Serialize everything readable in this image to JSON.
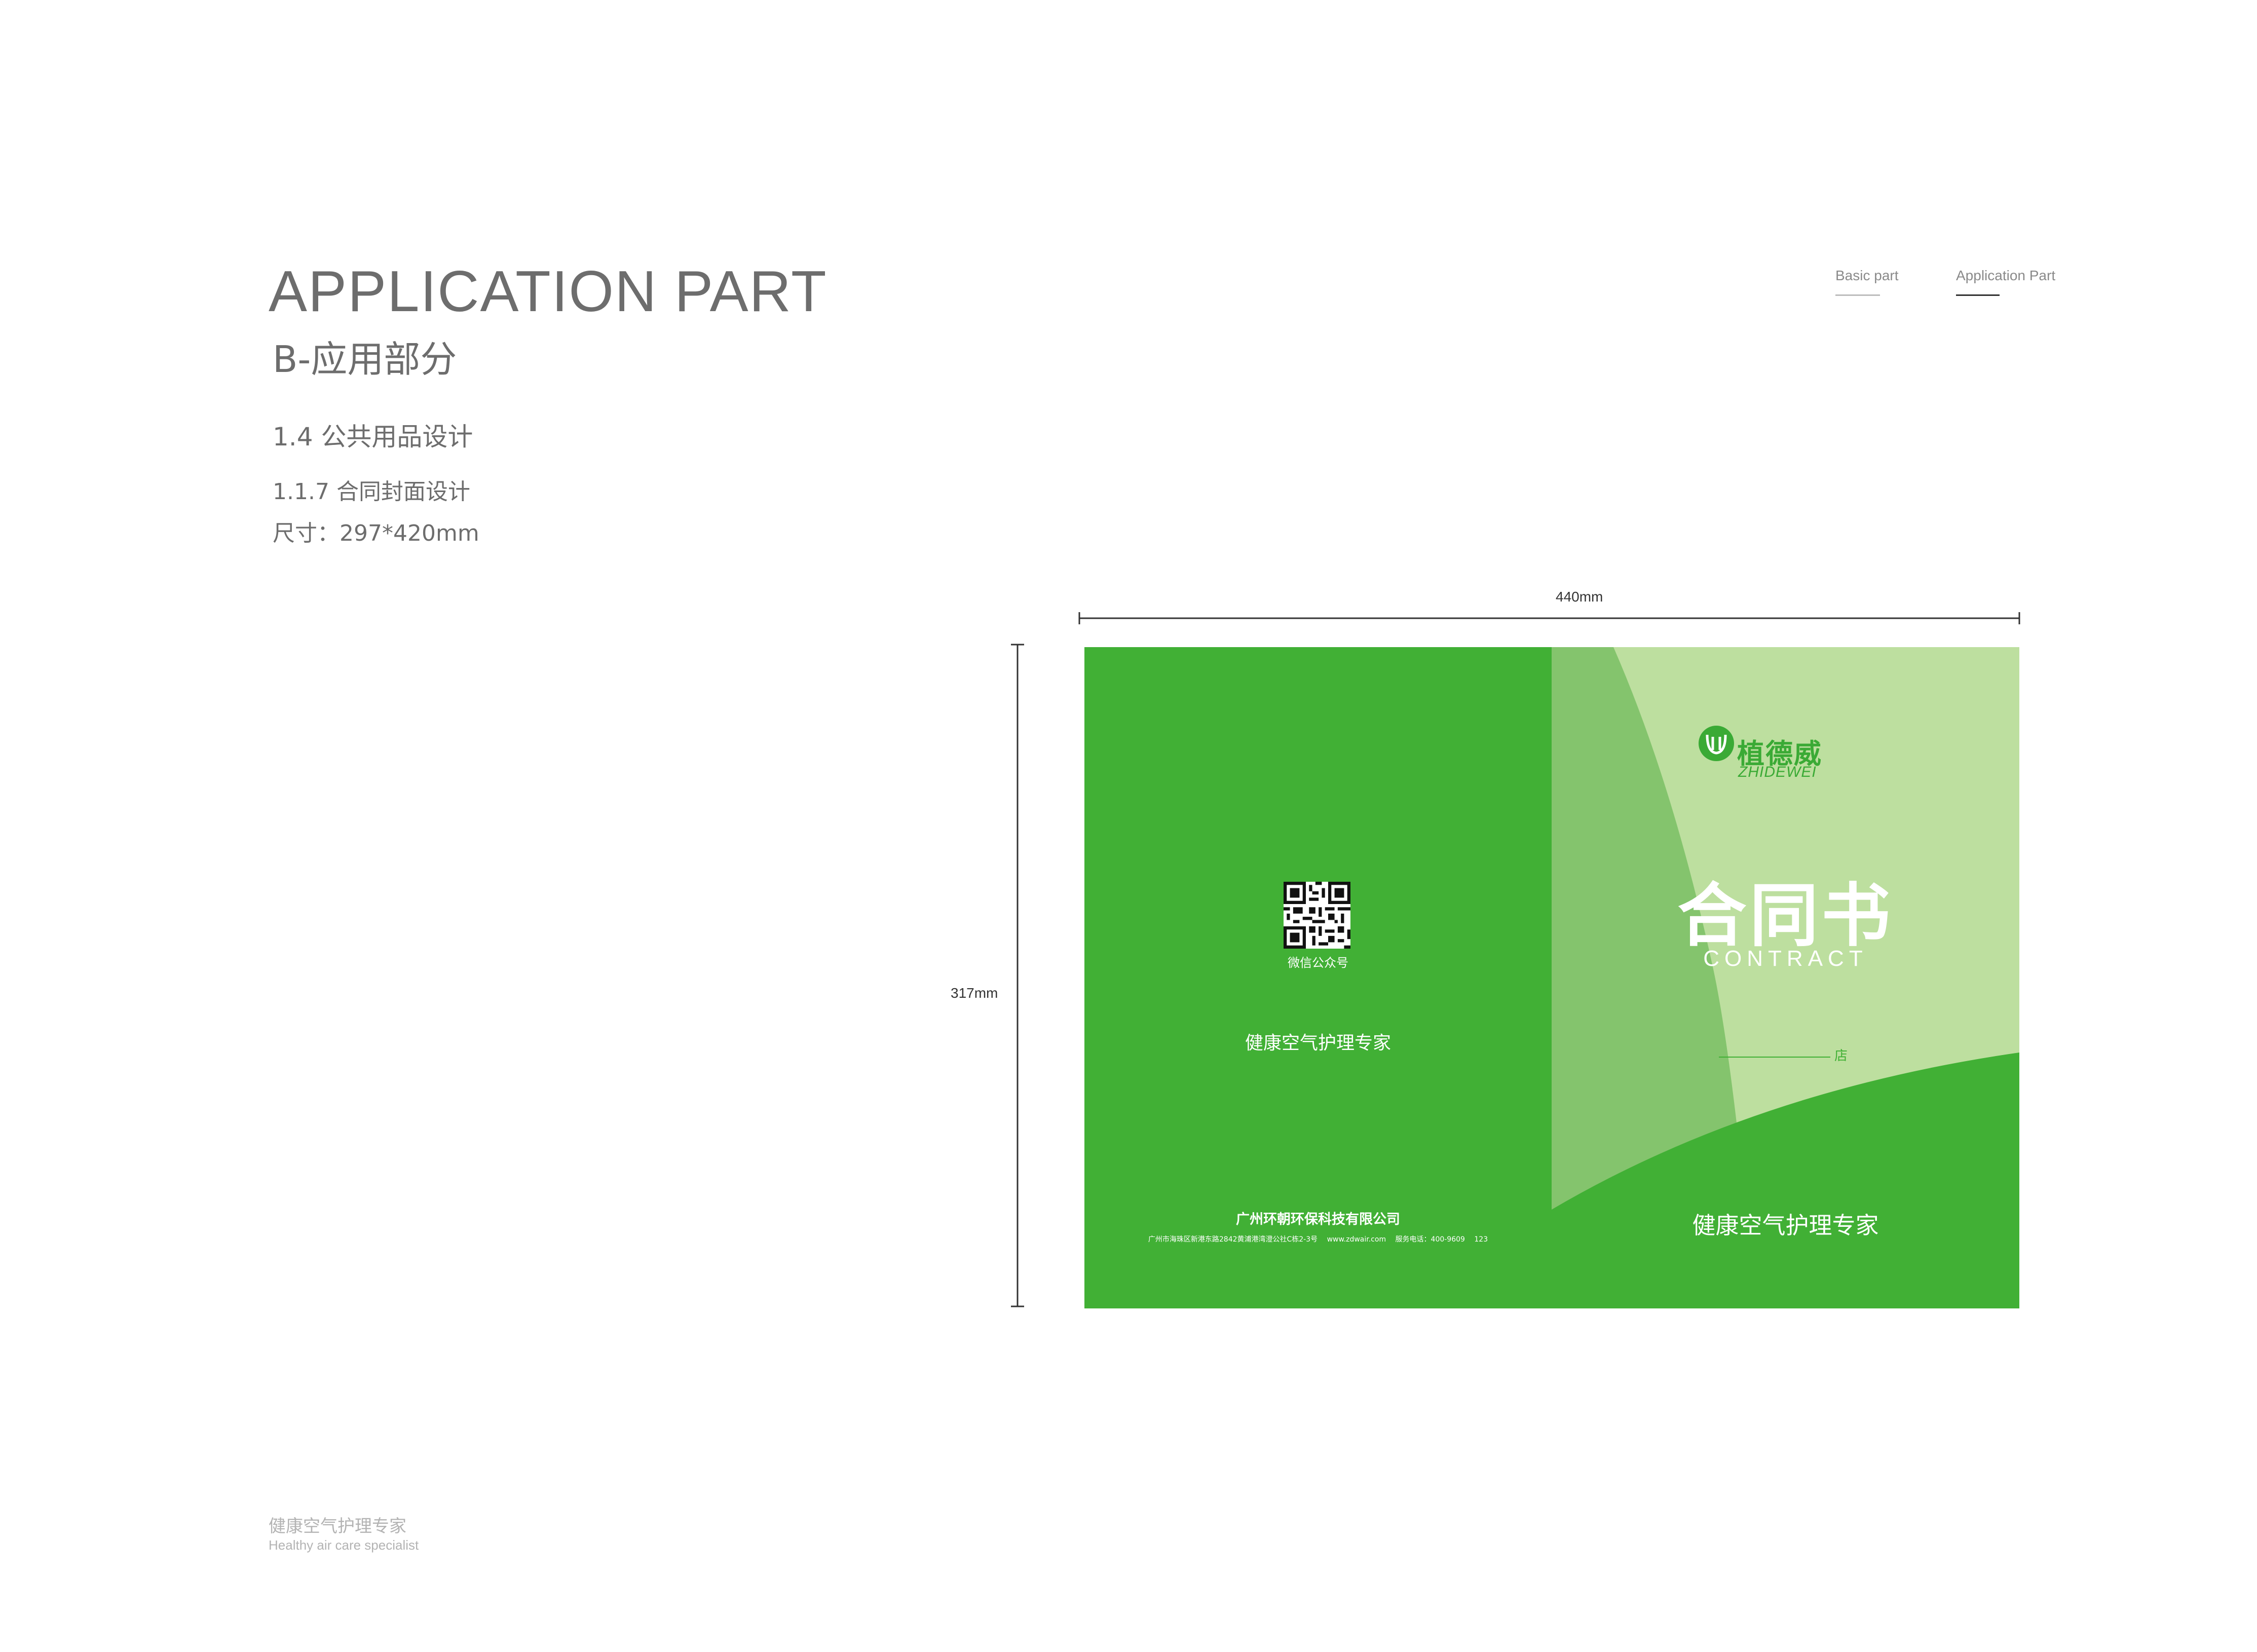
{
  "header": {
    "title_en": "APPLICATION PART",
    "title_cn": "B-应用部分",
    "section": "1.4 公共用品设计",
    "subsection": "1.1.7 合同封面设计",
    "size": "尺寸：297*420mm"
  },
  "nav": {
    "basic": "Basic part",
    "application": "Application Part"
  },
  "dimensions": {
    "width_label": "440mm",
    "height_label": "317mm"
  },
  "cover": {
    "back": {
      "qr_label": "微信公众号",
      "slogan": "健康空气护理专家",
      "company": "广州环朝环保科技有限公司",
      "contact": "广州市海珠区新港东路2842黄浦港湾澄公社C栋2-3号 www.zdwair.com 服务电话：400-9609 123"
    },
    "front": {
      "brand_cn": "植德威",
      "brand_en": "ZHIDEWEI",
      "title_cn": "合同书",
      "title_en": "CONTRACT",
      "store_suffix": "店",
      "slogan": "健康空气护理专家"
    },
    "colors": {
      "green": "#41b035",
      "mid_green": "#84c46d",
      "light_green": "#bddf9f"
    }
  },
  "footer": {
    "cn": "健康空气护理专家",
    "en": "Healthy air care specialist"
  }
}
